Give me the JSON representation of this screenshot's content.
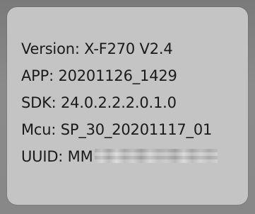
{
  "device_info": {
    "version": "Version: X-F270 V2.4",
    "app": "APP: 20201126_1429",
    "sdk": "SDK: 24.0.2.2.2.0.1.0",
    "mcu": "Mcu: SP_30_20201117_01",
    "uuid_label": "UUID: MM"
  }
}
